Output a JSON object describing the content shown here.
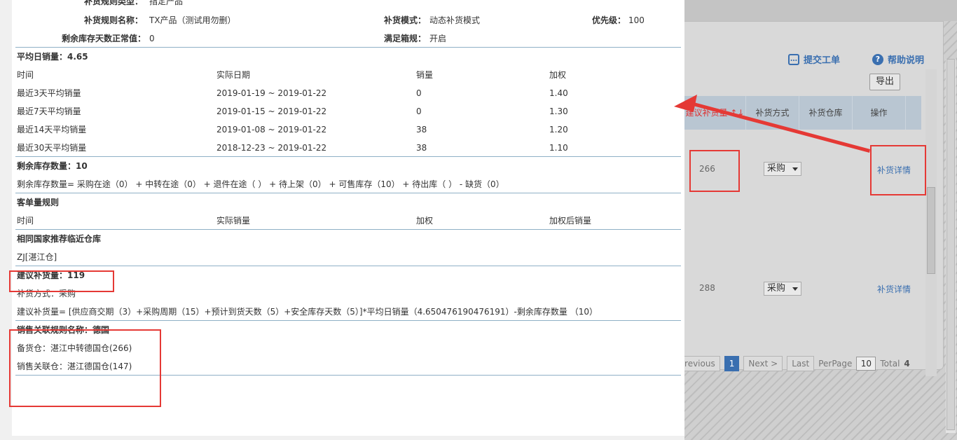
{
  "rule_header": {
    "type_label": "补货规则类型：",
    "type_value": "指定产品",
    "name_label": "补货规则名称：",
    "name_value": "TX产品（测试用勿删）",
    "mode_label": "补货模式：",
    "mode_value": "动态补货模式",
    "priority_label": "优先级：",
    "priority_value": "100",
    "stock_days_label": "剩余库存天数正常值：",
    "stock_days_value": "0",
    "satisfy_label": "满足箱规：",
    "satisfy_value": "开启"
  },
  "avg_sales": {
    "title": "平均日销量：4.65",
    "columns": [
      "时间",
      "实际日期",
      "销量",
      "加权"
    ],
    "rows": [
      [
        "最近3天平均销量",
        "2019-01-19 ~ 2019-01-22",
        "0",
        "1.40"
      ],
      [
        "最近7天平均销量",
        "2019-01-15 ~ 2019-01-22",
        "0",
        "1.30"
      ],
      [
        "最近14天平均销量",
        "2019-01-08 ~ 2019-01-22",
        "38",
        "1.20"
      ],
      [
        "最近30天平均销量",
        "2018-12-23 ~ 2019-01-22",
        "38",
        "1.10"
      ]
    ]
  },
  "remaining_stock": {
    "title": "剩余库存数量：10",
    "formula": "剩余库存数量= 采购在途（0） + 中转在途（0） + 退件在途（ ） + 待上架（0） + 可售库存（10） + 待出库（ ） - 缺货（0）"
  },
  "order_rule": {
    "title": "客单量规则",
    "columns": [
      "时间",
      "实际销量",
      "加权",
      "加权后销量"
    ]
  },
  "nearby_warehouse": {
    "title": "相同国家推荐临近仓库",
    "value": "ZJ[湛江仓]"
  },
  "suggest": {
    "title": "建议补货量：119",
    "method": "补货方式：采购",
    "formula": "建议补货量= [供应商交期（3）+采购周期（15）+预计到货天数（5）+安全库存天数（5）]*平均日销量（4.650476190476191）-剩余库存数量 （10）"
  },
  "sales_link": {
    "title": "销售关联规则名称：德国",
    "backup": "备货仓：湛江中转德国仓(266)",
    "linked": "销售关联仓：湛江德国仓(147)"
  },
  "background": {
    "submit_ticket": "提交工单",
    "help": "帮助说明",
    "export": "导出",
    "columns": [
      "建议补货量 ↑↓",
      "补货方式",
      "补货仓库",
      "操作"
    ],
    "rows": [
      {
        "qty": "266",
        "method": "采购",
        "action": "补货详情"
      },
      {
        "qty": "288",
        "method": "采购",
        "action": "补货详情"
      }
    ],
    "pager": {
      "prev": "Previous",
      "page": "1",
      "next": "Next >",
      "last": "Last",
      "per_page_label": "PerPage",
      "per_page": "10",
      "total_label": "Total",
      "total": "4"
    }
  },
  "colors": {
    "highlight": "#e53935",
    "link": "#3a6fb0",
    "separator": "#8fb0c6"
  }
}
